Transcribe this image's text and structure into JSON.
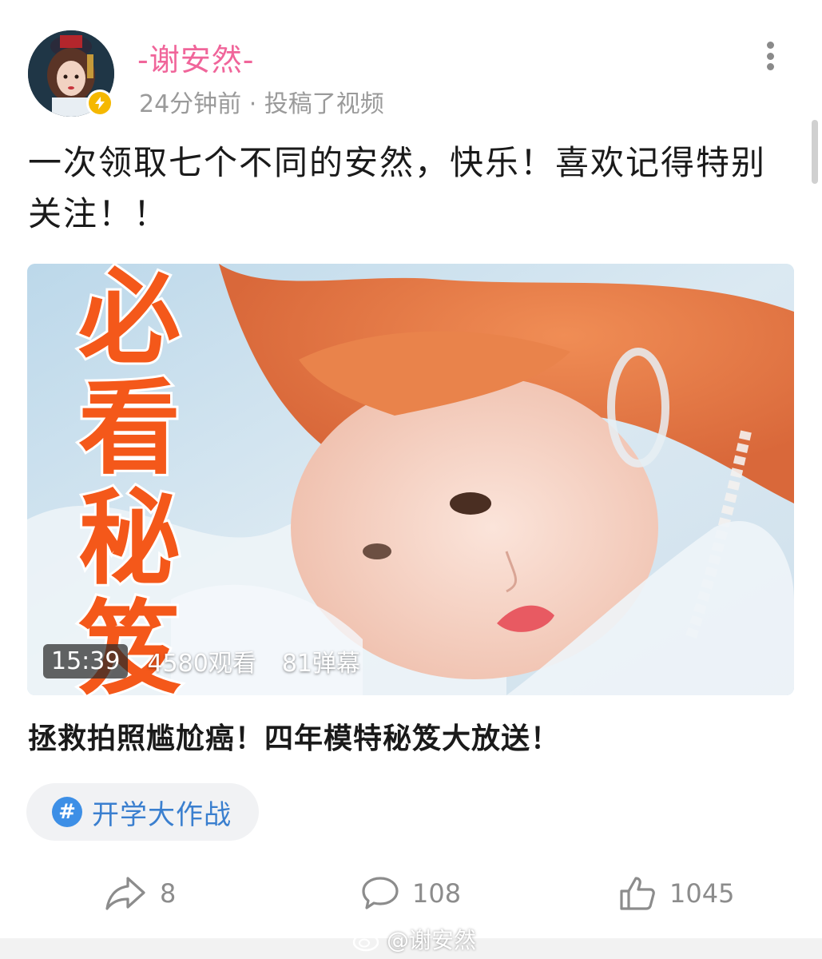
{
  "author": {
    "name": "-谢安然-",
    "meta": "24分钟前 · 投稿了视频",
    "verified": true
  },
  "post": {
    "text": "一次领取七个不同的安然，快乐！喜欢记得特别关注！！"
  },
  "video": {
    "overlay_chars": [
      "必",
      "看",
      "秘",
      "笈"
    ],
    "duration": "15:39",
    "views": "4580观看",
    "danmaku": "81弹幕",
    "title": "拯救拍照尴尬癌！四年模特秘笈大放送！"
  },
  "topic": {
    "icon_glyph": "#",
    "label": "开学大作战"
  },
  "actions": {
    "share_count": "8",
    "comment_count": "108",
    "like_count": "1045"
  },
  "watermark": {
    "text": "@谢安然"
  },
  "colors": {
    "username": "#f0659a",
    "topic_text": "#3a7fcf",
    "topic_icon": "#3d8fe6",
    "overlay_text": "#f4581a",
    "verify_badge": "#f5b800"
  },
  "icons": {
    "more": "more-vertical-icon",
    "verify": "lightning-icon",
    "share": "share-icon",
    "comment": "comment-icon",
    "like": "thumbs-up-icon",
    "watermark": "weibo-logo-icon"
  }
}
